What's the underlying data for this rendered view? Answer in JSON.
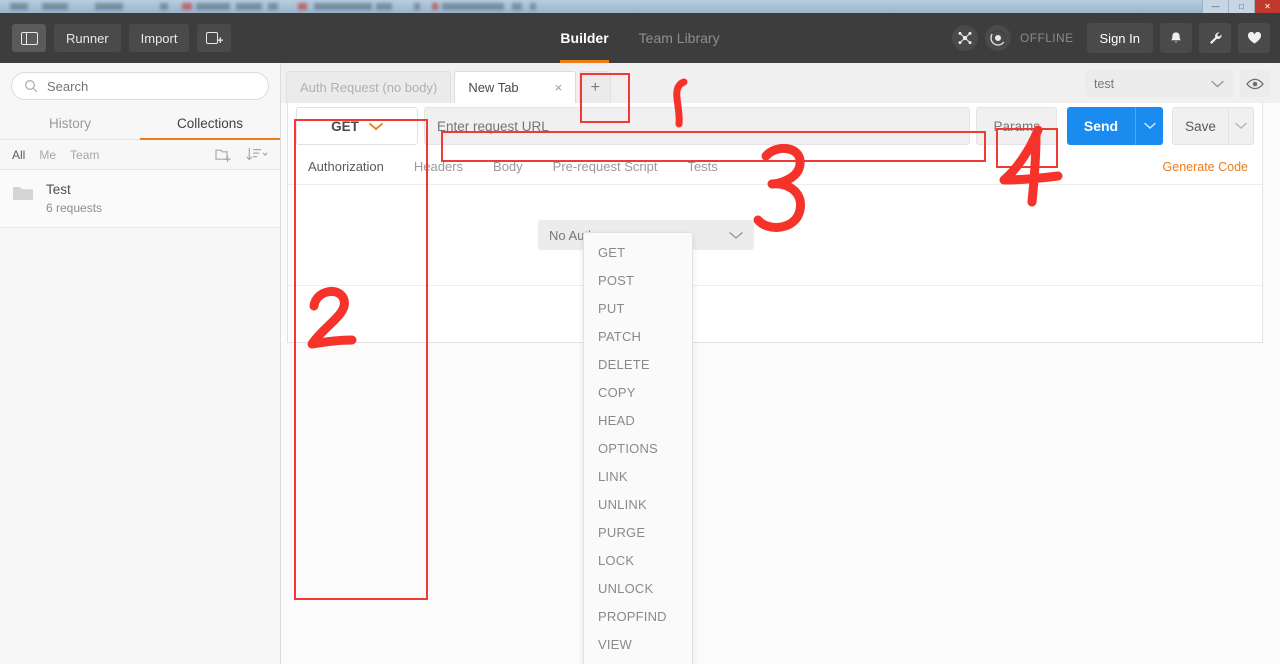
{
  "window": {
    "buttons": [
      "minimize",
      "maximize",
      "close"
    ]
  },
  "header": {
    "sidebar_toggle_label": "",
    "runner_label": "Runner",
    "import_label": "Import",
    "new_tab_label": "",
    "nav": [
      {
        "label": "Builder",
        "active": true
      },
      {
        "label": "Team Library",
        "active": false
      }
    ],
    "status_label": "OFFLINE",
    "sign_in_label": "Sign In",
    "icons": [
      "network-icon",
      "sync-status-icon",
      "bell-icon",
      "wrench-icon",
      "heart-icon"
    ]
  },
  "sidebar": {
    "search": {
      "placeholder": "Search",
      "value": ""
    },
    "tabs": [
      {
        "label": "History",
        "active": false
      },
      {
        "label": "Collections",
        "active": true
      }
    ],
    "filters": [
      {
        "label": "All",
        "active": true
      },
      {
        "label": "Me",
        "active": false
      },
      {
        "label": "Team",
        "active": false
      }
    ],
    "actions": [
      "new-folder-icon",
      "sort-icon"
    ],
    "collections": [
      {
        "name": "Test",
        "meta": "6 requests"
      }
    ]
  },
  "main": {
    "tabs": [
      {
        "label": "Auth Request (no body)",
        "active": false,
        "closable": false
      },
      {
        "label": "New Tab",
        "active": true,
        "closable": true
      }
    ],
    "close_glyph": "×",
    "add_tab_label": "+",
    "environment": {
      "value": "test",
      "chevron": "chevron-down-icon"
    },
    "eye_icon": "eye-icon",
    "request": {
      "method": "GET",
      "url_placeholder": "Enter request URL",
      "url_value": "",
      "params_label": "Params",
      "send_label": "Send",
      "save_label": "Save",
      "generate_code_label": "Generate Code",
      "subtabs": [
        {
          "label": "Authorization",
          "active": true
        },
        {
          "label": "Headers",
          "active": false
        },
        {
          "label": "Body",
          "active": false
        },
        {
          "label": "Pre-request Script",
          "active": false
        },
        {
          "label": "Tests",
          "active": false
        }
      ],
      "auth_type": "No Auth"
    },
    "method_menu": {
      "open": true,
      "items": [
        "GET",
        "POST",
        "PUT",
        "PATCH",
        "DELETE",
        "COPY",
        "HEAD",
        "OPTIONS",
        "LINK",
        "UNLINK",
        "PURGE",
        "LOCK",
        "UNLOCK",
        "PROPFIND",
        "VIEW"
      ]
    }
  },
  "annotations": {
    "color": "#ef3b33",
    "marks": [
      {
        "label": "1",
        "target": "add-tab-button"
      },
      {
        "label": "2",
        "target": "method-dropdown-menu"
      },
      {
        "label": "3",
        "target": "url-input"
      },
      {
        "label": "4",
        "target": "params-button"
      }
    ]
  },
  "colors": {
    "header_bg": "#3d3d3d",
    "accent_orange": "#ef7c1a",
    "send_blue": "#1a8cf0",
    "annotation_red": "#ef3b33"
  }
}
